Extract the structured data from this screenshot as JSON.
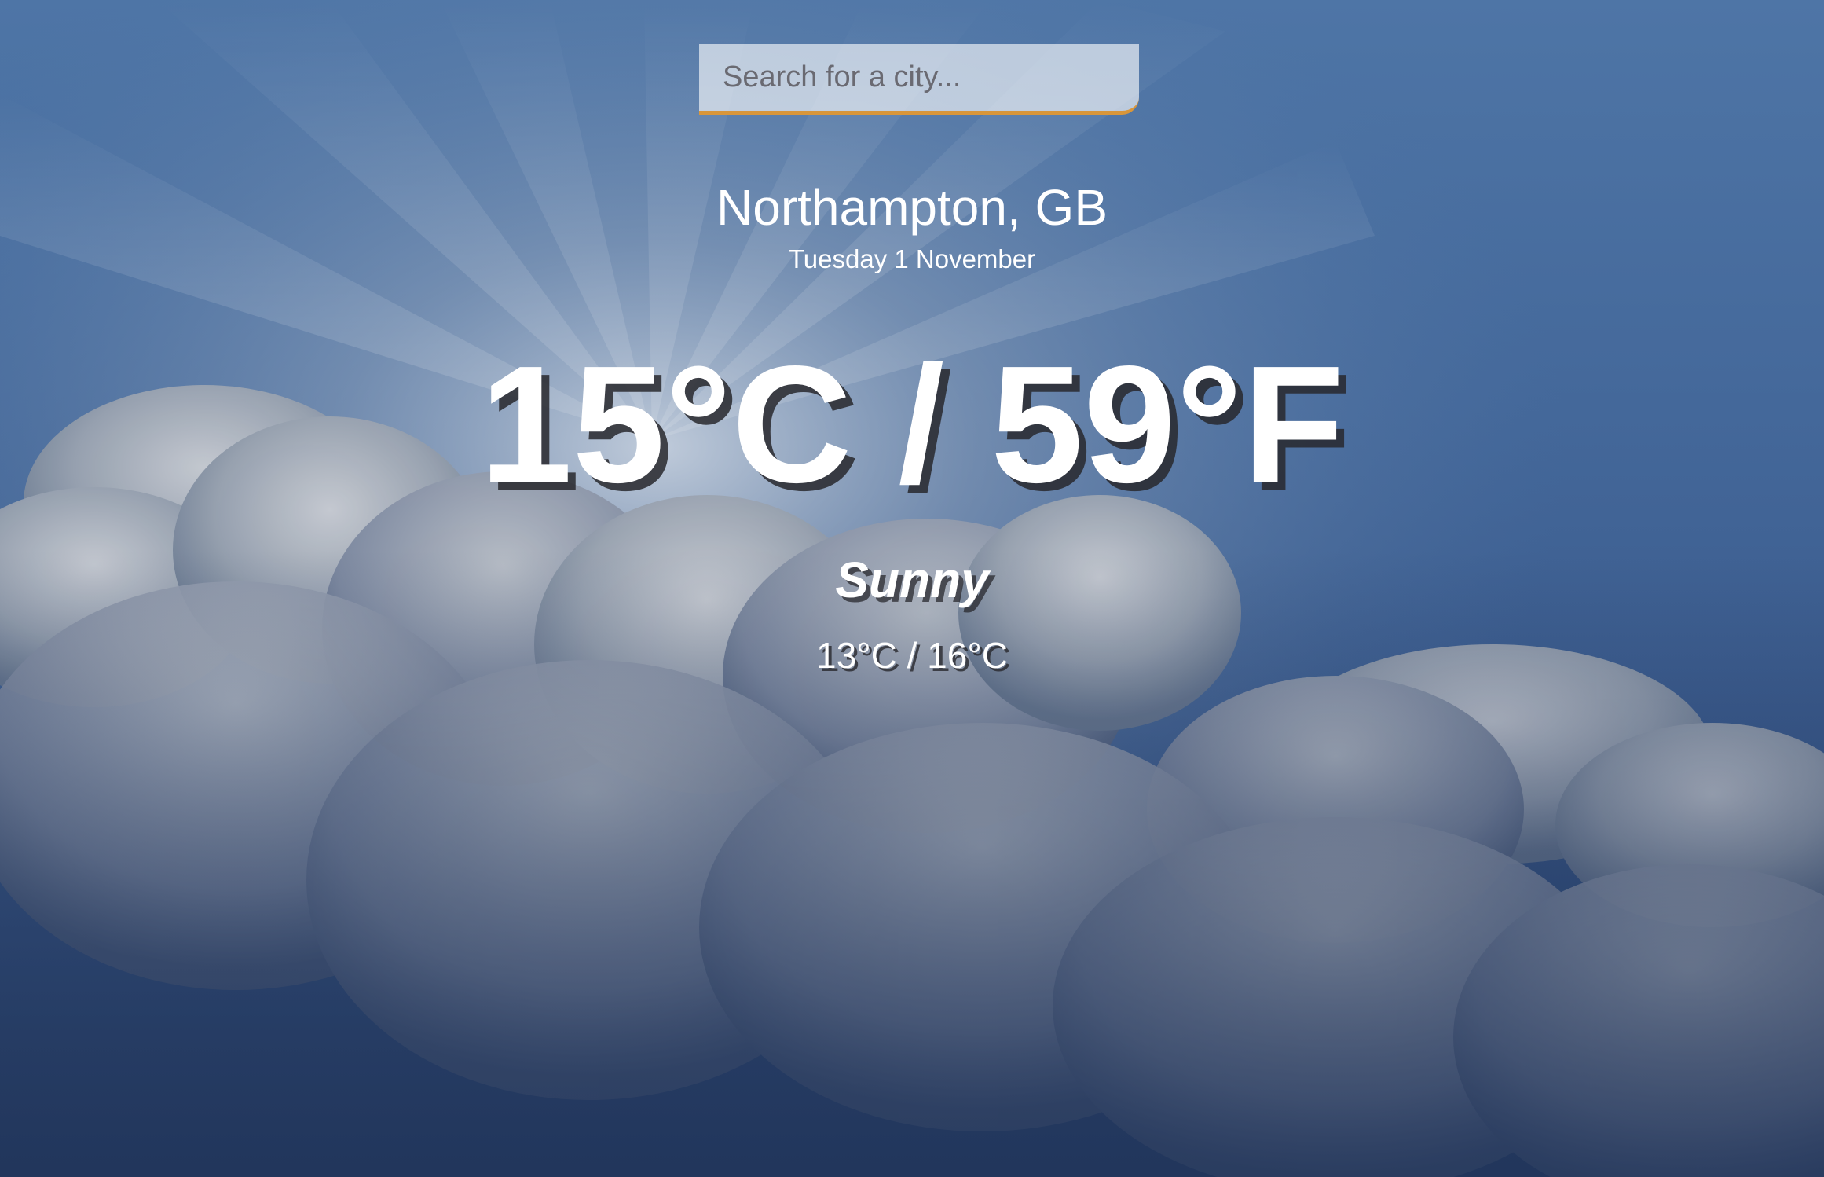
{
  "search": {
    "placeholder": "Search for a city...",
    "value": ""
  },
  "location": {
    "name": "Northampton, GB",
    "date": "Tuesday 1 November"
  },
  "weather": {
    "temperature": "15°C / 59°F",
    "condition": "Sunny",
    "range": "13°C / 16°C"
  },
  "colors": {
    "search_accent": "#d9963a",
    "text": "#ffffff",
    "sky_top": "#4e75a6",
    "sky_bottom": "#2a426a"
  }
}
